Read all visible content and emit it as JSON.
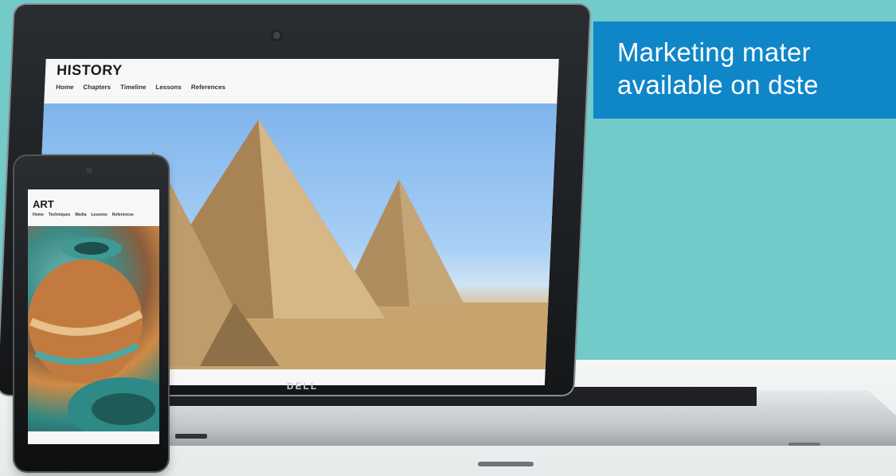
{
  "banner": {
    "line1": "Marketing mater",
    "line2": "available on dste"
  },
  "laptop": {
    "brand": "DELL",
    "site": {
      "title": "HISTORY",
      "nav": [
        "Home",
        "Chapters",
        "Timeline",
        "Lessons",
        "References"
      ],
      "hero_image": "pyramids-image"
    }
  },
  "tablet": {
    "site": {
      "title": "ART",
      "nav": [
        "Home",
        "Techniques",
        "Media",
        "Lessons",
        "References"
      ],
      "hero_image": "pottery-image"
    }
  },
  "colors": {
    "background": "#72cac9",
    "banner": "#0f86c8",
    "floor": "#eef1f1"
  }
}
